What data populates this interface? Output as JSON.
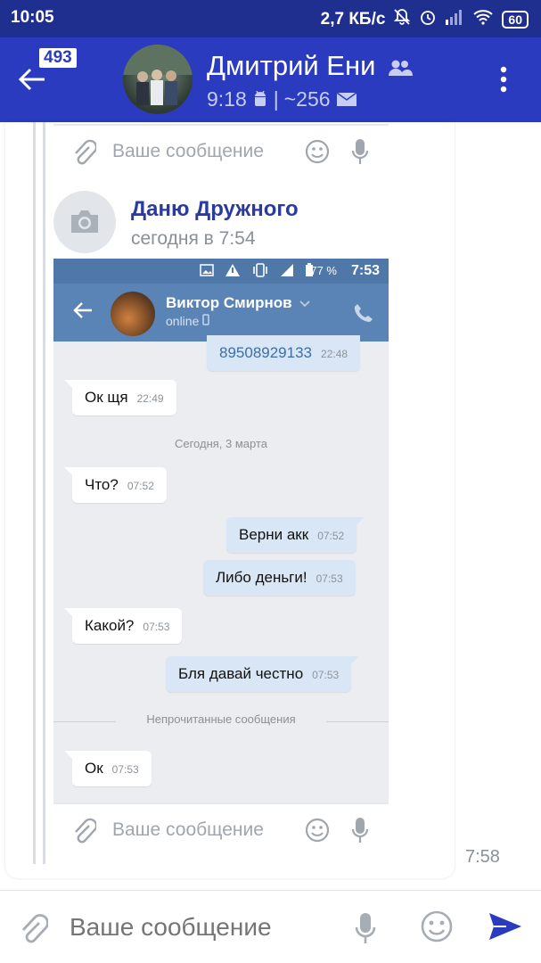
{
  "status_bar": {
    "time": "10:05",
    "network_speed": "2,7 КБ/с",
    "battery": "60"
  },
  "header": {
    "back_badge": "493",
    "name": "Дмитрий Ени",
    "subtitle_time": "9:18",
    "subtitle_count": "~256"
  },
  "message": {
    "forward_input_placeholder": "Ваше сообщение",
    "sender_name": "Даню Дружного",
    "sender_time": "сегодня в 7:54",
    "bottom_input_placeholder": "Ваше сообщение",
    "time": "7:58"
  },
  "screenshot": {
    "status_battery": "77 %",
    "status_time": "7:53",
    "contact_name": "Виктор Смирнов",
    "contact_status": "online",
    "messages": [
      {
        "dir": "out",
        "text": "89508929133",
        "time": "22:48"
      },
      {
        "dir": "in",
        "text": "Ок щя",
        "time": "22:49"
      },
      {
        "dir": "in",
        "text": "Что?",
        "time": "07:52"
      },
      {
        "dir": "out",
        "text": "Верни акк",
        "time": "07:52"
      },
      {
        "dir": "out",
        "text": "Либо деньги!",
        "time": "07:53"
      },
      {
        "dir": "in",
        "text": "Какой?",
        "time": "07:53"
      },
      {
        "dir": "out",
        "text": "Бля давай честно",
        "time": "07:53"
      },
      {
        "dir": "in",
        "text": "Ок",
        "time": "07:53"
      }
    ],
    "date_separator": "Сегодня, 3 марта",
    "unread_separator": "Непрочитанные сообщения"
  },
  "composer": {
    "placeholder": "Ваше сообщение"
  },
  "colors": {
    "status_bar": "#1f2f8f",
    "header": "#2a3bbf",
    "name_accent": "#2a3a9e",
    "screenshot_header": "#5b84b6",
    "outgoing_bubble": "#d8e6f5",
    "send_icon": "#2a3bbf"
  },
  "icons": [
    "back-arrow-icon",
    "android-icon",
    "mail-icon",
    "group-icon",
    "more-vert-icon",
    "attach-icon",
    "emoji-icon",
    "mic-icon",
    "camera-icon",
    "send-icon",
    "phone-icon",
    "alarm-icon",
    "wifi-icon",
    "signal-icon"
  ]
}
